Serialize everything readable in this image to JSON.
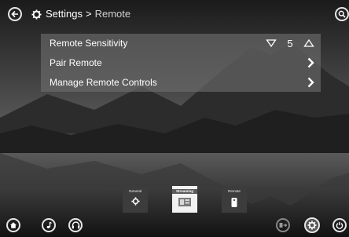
{
  "header": {
    "section": "Settings",
    "separator": ">",
    "current": "Remote"
  },
  "menu": {
    "items": [
      {
        "label": "Remote Sensitivity",
        "value": "5"
      },
      {
        "label": "Pair Remote"
      },
      {
        "label": "Manage Remote Controls"
      }
    ]
  },
  "tiles": [
    {
      "label": "General",
      "icon": "gear-icon",
      "selected": false
    },
    {
      "label": "Streaming",
      "icon": "streaming-icon",
      "selected": true
    },
    {
      "label": "Remote",
      "icon": "remote-icon",
      "selected": false
    }
  ],
  "icons": {
    "back": "back-arrow-icon",
    "search": "search-icon",
    "home": "home-icon",
    "music": "music-note-icon",
    "headphones": "headphones-icon",
    "input": "input-source-icon",
    "settings": "gear-icon",
    "power": "power-icon"
  },
  "colors": {
    "tile_selected": "#ffffff",
    "tile_default": "#3a3a3a",
    "panel": "#6e6e6e"
  }
}
